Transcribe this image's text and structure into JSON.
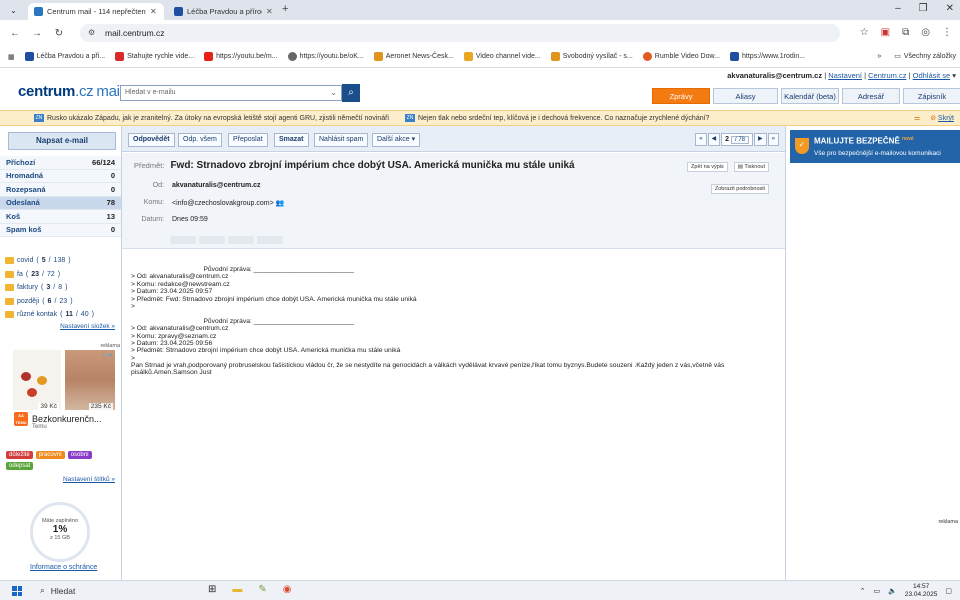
{
  "browser": {
    "tabs": [
      {
        "title": "Centrum mail - 114 nepřečtený",
        "active": true
      },
      {
        "title": "Léčba Pravdou a přírodními pr",
        "active": false
      }
    ],
    "url": "mail.centrum.cz",
    "bookmarks": [
      "Léčba Pravdou a při...",
      "Stahujte rychle vide...",
      "https://youtu.be/m...",
      "https://youtu.be/oK...",
      "Aeronet News-Česk...",
      "Video channel vide...",
      "Svobodný vysílač - s...",
      "Rumble Video Dow...",
      "https://www.1rodin..."
    ],
    "all_bookmarks": "Všechny záložky"
  },
  "header": {
    "logo_main": "centrum",
    "logo_cz": ".cz",
    "logo_mail": "mail",
    "search_placeholder": "Hledat v e-mailu",
    "user_email": "akvanaturalis@centrum.cz",
    "user_links": [
      "Nastavení",
      "Centrum.cz",
      "Odhlásit se"
    ],
    "tabs": [
      {
        "label": "Zprávy",
        "active": true
      },
      {
        "label": "Aliasy",
        "active": false
      },
      {
        "label": "Kalendář (beta)",
        "active": false
      },
      {
        "label": "Adresář",
        "active": false
      },
      {
        "label": "Zápisník",
        "active": false
      }
    ]
  },
  "news": {
    "item1": "Rusko ukázalo Západu, jak je zranitelný. Za útoky na evropská letiště stojí agenti GRU, zjistili němečtí novináři",
    "item2": "Nejen tlak nebo srdeční tep, klíčová je i dechová frekvence. Co naznačuje zrychlené dýchání?",
    "hide": "Skrýt"
  },
  "sidebar": {
    "write_label": "Napsat e-mail",
    "folders": [
      {
        "name": "Příchozí",
        "count": "66/124"
      },
      {
        "name": "Hromadná",
        "count": "0"
      },
      {
        "name": "Rozepsaná",
        "count": "0"
      },
      {
        "name": "Odeslaná",
        "count": "78"
      },
      {
        "name": "Koš",
        "count": "13"
      },
      {
        "name": "Spam koš",
        "count": "0"
      }
    ],
    "subfolders": [
      {
        "name": "covid",
        "count": "5",
        "total": "138"
      },
      {
        "name": "fa",
        "count": "23",
        "total": "72"
      },
      {
        "name": "faktury",
        "count": "3",
        "total": "8"
      },
      {
        "name": "později",
        "count": "6",
        "total": "23"
      },
      {
        "name": "různé kontak",
        "count": "11",
        "total": "40"
      }
    ],
    "folder_settings": "Nastavení složek »",
    "ad_label": "reklama",
    "ad_price1": "39 Kč",
    "ad_price2": "235 Kč",
    "ad_title": "Bezkonkurenčn...",
    "ad_brand": "Temu",
    "labels": [
      {
        "name": "důležité",
        "color": "#d23c3c"
      },
      {
        "name": "pracovní",
        "color": "#f08a1c"
      },
      {
        "name": "osobní",
        "color": "#8a3cc8"
      },
      {
        "name": "odepsat",
        "color": "#5aa43c"
      }
    ],
    "label_settings": "Nastavení štítků »",
    "storage_caption": "Máte zaplněno",
    "storage_pct": "1%",
    "storage_total": "z 15 GB",
    "privacy": "Informace o schránce"
  },
  "toolbar": {
    "reply": "Odpovědět",
    "reply_all": "Odp. všem",
    "forward": "Přeposlat",
    "delete": "Smazat",
    "spam": "Nahlásit spam",
    "more": "Další akce",
    "page": "2",
    "page_total": "/ 78"
  },
  "message": {
    "subject_label": "Předmět:",
    "subject": "Fwd: Strnadovo zbrojní impérium chce dobýt USA. Americká munička mu stále uniká",
    "back_btn": "Zpět na výpis",
    "print_btn": "Tisknout",
    "details_btn": "Zobrazit podrobnosti",
    "from_label": "Od:",
    "from": "akvanaturalis@centrum.cz",
    "to_label": "Komu:",
    "to": "<info@czechoslovakgroup.com>",
    "date_label": "Datum:",
    "date": "Dnes 09:59",
    "body_lines": [
      "                                       Původní zpráva: ___________________________",
      "> Od: akvanaturalis@centrum.cz",
      "> Komu: redakce@newstream.cz",
      "> Datum: 23.04.2025 09:57",
      "> Předmět: Fwd: Strnadovo zbrojní impérium chce dobýt USA. Americká munička mu stále uniká",
      ">",
      "",
      "                                       Původní zpráva: ___________________________",
      "> Od: akvanaturalis@centrum.cz",
      "> Komu: zpravy@seznam.cz",
      "> Datum: 23.04.2025 09:56",
      "> Předmět: Strnadovo zbrojní impérium chce dobýt USA. Americká munička mu stále uniká",
      ">"
    ],
    "body_paragraph": "Pan Strnad je vrah,podporovaný probruselskou  fašistickou vládou čr, že se nestydíte na genocidách a válkách vydělávat krvavé peníze,říkat tomu byznys.Budete souzeni .Každý jeden z vás,včetně vás pisálků.Amen.Samson Just"
  },
  "right": {
    "secure_title": "MAILUJTE BEZPEČNĚ",
    "secure_new": "nové",
    "secure_sub": "Vše pro bezpečnější e-mailovou komunikaci",
    "ad_label": "reklama"
  },
  "taskbar": {
    "search": "Hledat",
    "time": "14:57",
    "date": "23.04.2025"
  }
}
